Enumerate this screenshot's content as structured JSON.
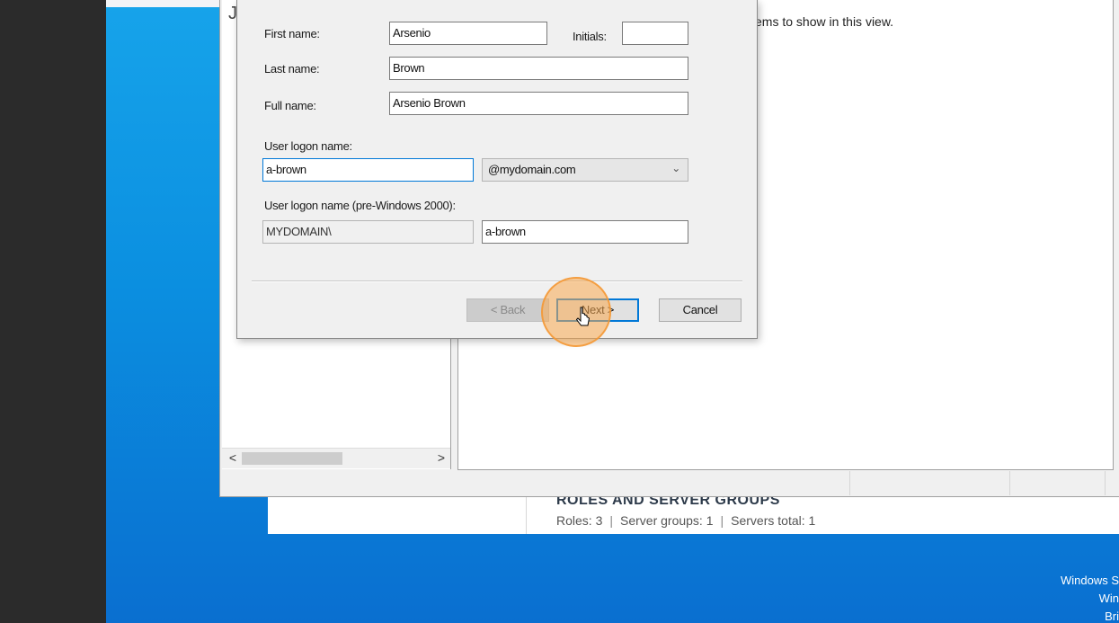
{
  "server_manager": {
    "roles_title": "ROLES AND SERVER GROUPS",
    "roles_count": "Roles: 3",
    "server_groups": "Server groups: 1",
    "servers_total": "Servers total: 1",
    "separator": "|"
  },
  "aduc": {
    "empty_message": "There are no items to show in this view.",
    "empty_message_visible": "ems to show in this view.",
    "scroll_left": "<",
    "scroll_right": ">"
  },
  "dialog": {
    "first_name_label": "First name:",
    "first_name_value": "Arsenio",
    "initials_label": "Initials:",
    "initials_value": "",
    "last_name_label": "Last name:",
    "last_name_value": "Brown",
    "full_name_label": "Full name:",
    "full_name_value": "Arsenio Brown",
    "logon_name_label": "User logon name:",
    "logon_name_value": "a-brown",
    "domain_suffix": "@mydomain.com",
    "pre2000_label": "User logon name (pre-Windows 2000):",
    "pre2000_domain": "MYDOMAIN\\",
    "pre2000_value": "a-brown",
    "back_button": "< Back",
    "next_button": "Next >",
    "cancel_button": "Cancel"
  },
  "watermark": {
    "line1": "Windows S",
    "line2": "Win",
    "line3": "Bri"
  },
  "colors": {
    "accent": "#0078d7",
    "desktop": "#0b8fe0",
    "click_highlight": "#f7a54a"
  },
  "icons": [
    "chevron-down-icon",
    "mouse-cursor-icon",
    "scroll-left-icon",
    "scroll-right-icon"
  ]
}
